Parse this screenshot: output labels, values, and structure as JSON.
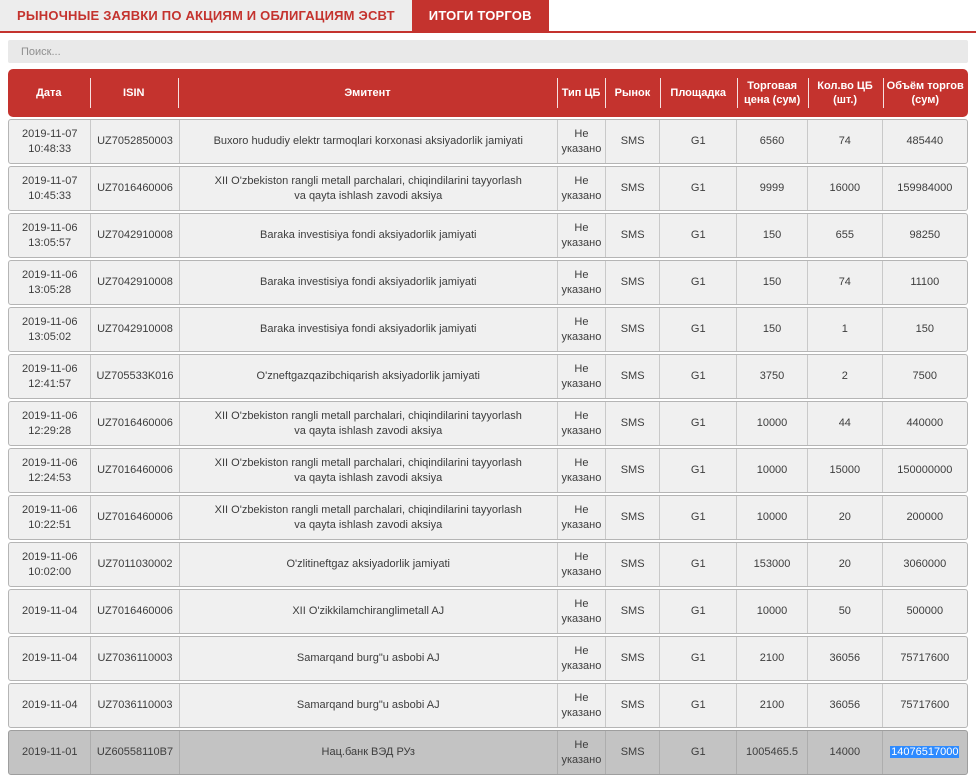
{
  "tabs": [
    {
      "label": "РЫНОЧНЫЕ ЗАЯВКИ ПО АКЦИЯМ И ОБЛИГАЦИЯМ ЭСВТ",
      "active": false
    },
    {
      "label": "ИТОГИ ТОРГОВ",
      "active": true
    }
  ],
  "search": {
    "placeholder": "Поиск..."
  },
  "colors": {
    "accent": "#c4332e",
    "row_bg": "#f0f0f0",
    "row_border": "#b5b5b5",
    "highlight_row": "#c3c3c3",
    "selection_blue": "#2e8bff",
    "search_bg": "#e9e9e9",
    "tab_inactive_bg": "#ededed"
  },
  "table": {
    "columns": [
      {
        "key": "date",
        "label": "Дата"
      },
      {
        "key": "isin",
        "label": "ISIN"
      },
      {
        "key": "emitent",
        "label": "Эмитент"
      },
      {
        "key": "type",
        "label": "Тип ЦБ"
      },
      {
        "key": "market",
        "label": "Рынок"
      },
      {
        "key": "platform",
        "label": "Площадка"
      },
      {
        "key": "price",
        "label": "Торговая цена (сум)"
      },
      {
        "key": "qty",
        "label": "Кол.во ЦБ (шт.)"
      },
      {
        "key": "volume",
        "label": "Объём торгов (сум)"
      }
    ],
    "rows": [
      {
        "date": "2019-11-07",
        "time": "10:48:33",
        "isin": "UZ7052850003",
        "emitent": "Buxoro hududiy elektr tarmoqlari korxonasi aksiyadorlik jamiyati",
        "type": "Не указано",
        "market": "SMS",
        "platform": "G1",
        "price": "6560",
        "qty": "74",
        "volume": "485440"
      },
      {
        "date": "2019-11-07",
        "time": "10:45:33",
        "isin": "UZ7016460006",
        "emitent": "XII O'zbekiston rangli metall parchalari, chiqindilarini tayyorlash va qayta ishlash zavodi aksiya",
        "type": "Не указано",
        "market": "SMS",
        "platform": "G1",
        "price": "9999",
        "qty": "16000",
        "volume": "159984000"
      },
      {
        "date": "2019-11-06",
        "time": "13:05:57",
        "isin": "UZ7042910008",
        "emitent": "Baraka investisiya fondi aksiyadorlik jamiyati",
        "type": "Не указано",
        "market": "SMS",
        "platform": "G1",
        "price": "150",
        "qty": "655",
        "volume": "98250"
      },
      {
        "date": "2019-11-06",
        "time": "13:05:28",
        "isin": "UZ7042910008",
        "emitent": "Baraka investisiya fondi aksiyadorlik jamiyati",
        "type": "Не указано",
        "market": "SMS",
        "platform": "G1",
        "price": "150",
        "qty": "74",
        "volume": "11100"
      },
      {
        "date": "2019-11-06",
        "time": "13:05:02",
        "isin": "UZ7042910008",
        "emitent": "Baraka investisiya fondi aksiyadorlik jamiyati",
        "type": "Не указано",
        "market": "SMS",
        "platform": "G1",
        "price": "150",
        "qty": "1",
        "volume": "150"
      },
      {
        "date": "2019-11-06",
        "time": "12:41:57",
        "isin": "UZ705533K016",
        "emitent": "O'zneftgazqazibchiqarish aksiyadorlik jamiyati",
        "type": "Не указано",
        "market": "SMS",
        "platform": "G1",
        "price": "3750",
        "qty": "2",
        "volume": "7500"
      },
      {
        "date": "2019-11-06",
        "time": "12:29:28",
        "isin": "UZ7016460006",
        "emitent": "XII O'zbekiston rangli metall parchalari, chiqindilarini tayyorlash va qayta ishlash zavodi aksiya",
        "type": "Не указано",
        "market": "SMS",
        "platform": "G1",
        "price": "10000",
        "qty": "44",
        "volume": "440000"
      },
      {
        "date": "2019-11-06",
        "time": "12:24:53",
        "isin": "UZ7016460006",
        "emitent": "XII O'zbekiston rangli metall parchalari, chiqindilarini tayyorlash va qayta ishlash zavodi aksiya",
        "type": "Не указано",
        "market": "SMS",
        "platform": "G1",
        "price": "10000",
        "qty": "15000",
        "volume": "150000000"
      },
      {
        "date": "2019-11-06",
        "time": "10:22:51",
        "isin": "UZ7016460006",
        "emitent": "XII O'zbekiston rangli metall parchalari, chiqindilarini tayyorlash va qayta ishlash zavodi aksiya",
        "type": "Не указано",
        "market": "SMS",
        "platform": "G1",
        "price": "10000",
        "qty": "20",
        "volume": "200000"
      },
      {
        "date": "2019-11-06",
        "time": "10:02:00",
        "isin": "UZ7011030002",
        "emitent": "O'zlitineftgaz aksiyadorlik jamiyati",
        "type": "Не указано",
        "market": "SMS",
        "platform": "G1",
        "price": "153000",
        "qty": "20",
        "volume": "3060000"
      },
      {
        "date": "2019-11-04",
        "time": "",
        "isin": "UZ7016460006",
        "emitent": "XII O'zikkilamchiranglimetall AJ",
        "type": "Не указано",
        "market": "SMS",
        "platform": "G1",
        "price": "10000",
        "qty": "50",
        "volume": "500000"
      },
      {
        "date": "2019-11-04",
        "time": "",
        "isin": "UZ7036110003",
        "emitent": "Samarqand burg\"u asbobi AJ",
        "type": "Не указано",
        "market": "SMS",
        "platform": "G1",
        "price": "2100",
        "qty": "36056",
        "volume": "75717600"
      },
      {
        "date": "2019-11-04",
        "time": "",
        "isin": "UZ7036110003",
        "emitent": "Samarqand burg\"u asbobi AJ",
        "type": "Не указано",
        "market": "SMS",
        "platform": "G1",
        "price": "2100",
        "qty": "36056",
        "volume": "75717600"
      },
      {
        "date": "2019-11-01",
        "time": "",
        "isin": "UZ60558110B7",
        "emitent": "Нац.банк ВЭД РУз",
        "type": "Не указано",
        "market": "SMS",
        "platform": "G1",
        "price": "1005465.5",
        "qty": "14000",
        "volume": "14076517000",
        "highlighted": true,
        "volume_selected": true
      }
    ]
  }
}
